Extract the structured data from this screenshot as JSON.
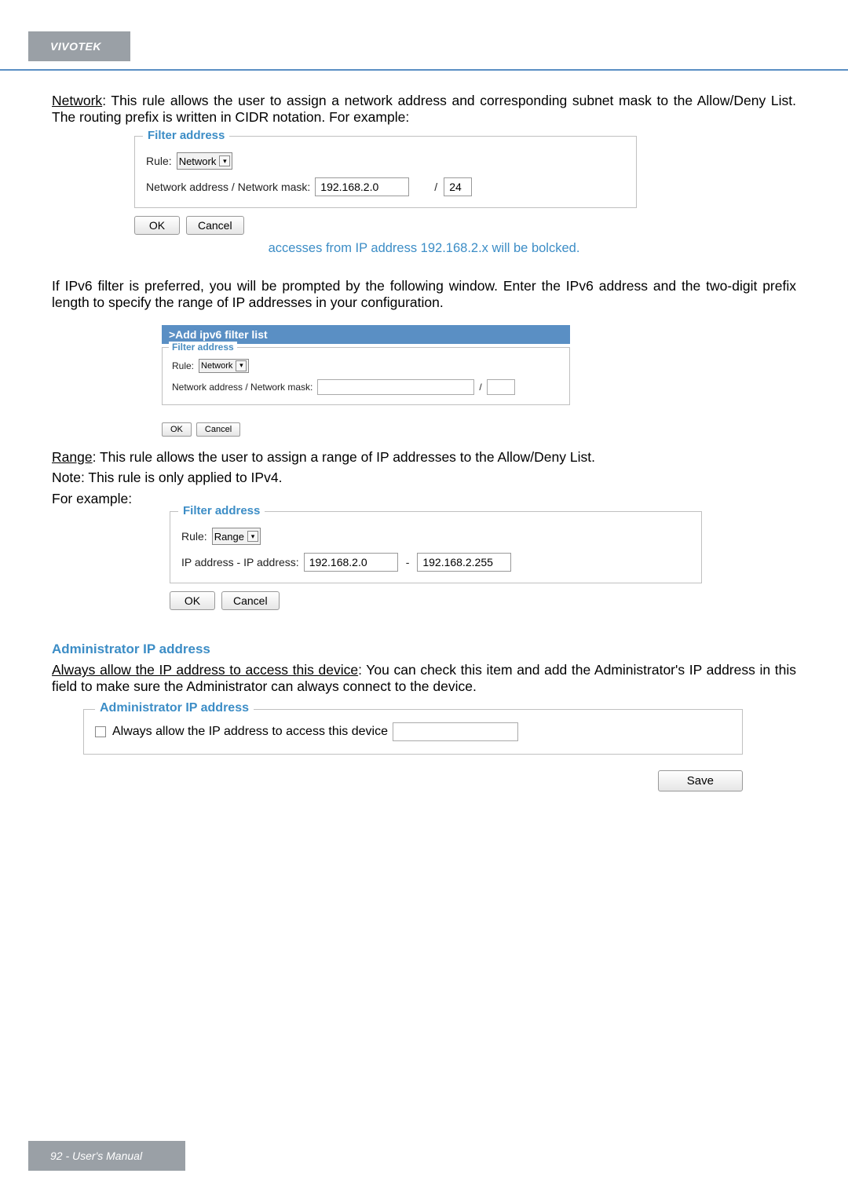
{
  "brand": "VIVOTEK",
  "networkPara": {
    "lead": "Network",
    "rest": ": This rule allows the user to assign a network address and corresponding subnet mask to the Allow/Deny List. The routing prefix is written in CIDR notation. For example:"
  },
  "filter1": {
    "legend": "Filter address",
    "ruleLabel": "Rule:",
    "ruleValue": "Network",
    "addrLabel": "Network address / Network mask:",
    "addrValue": "192.168.2.0",
    "slash": "/",
    "maskValue": "24",
    "okBtn": "OK",
    "cancelBtn": "Cancel"
  },
  "caption1": "accesses from IP address 192.168.2.x will be bolcked.",
  "ipv6Para": "If IPv6 filter is preferred, you will be prompted by the following window. Enter the IPv6 address and the two-digit prefix length to specify the range of IP addresses in your configuration.",
  "ipv6Box": {
    "titleBar": ">Add ipv6 filter list",
    "legend": "Filter address",
    "ruleLabel": "Rule:",
    "ruleValue": "Network",
    "addrLabel": "Network address / Network mask:",
    "slash": "/",
    "okBtn": "OK",
    "cancelBtn": "Cancel"
  },
  "rangePara": {
    "lead": "Range",
    "rest": ": This rule allows the user to assign a range of IP addresses to the Allow/Deny List."
  },
  "rangeNote": "Note: This rule is only applied to IPv4.",
  "rangeFor": "For example:",
  "filter2": {
    "legend": "Filter address",
    "ruleLabel": "Rule:",
    "ruleValue": "Range",
    "addrLabel": "IP address - IP address:",
    "addr1": "192.168.2.0",
    "dash": "-",
    "addr2": "192.168.2.255",
    "okBtn": "OK",
    "cancelBtn": "Cancel"
  },
  "adminHead": "Administrator IP address",
  "adminPara": {
    "lead": "Always allow the IP address to access this device",
    "rest": ": You can check this item and add the Administrator's IP address in this field to make sure the Administrator can always connect to the device."
  },
  "adminBox": {
    "legend": "Administrator IP address",
    "checkboxLabel": "Always allow the IP address to access this device"
  },
  "saveBtn": "Save",
  "footer": "92 - User's Manual"
}
